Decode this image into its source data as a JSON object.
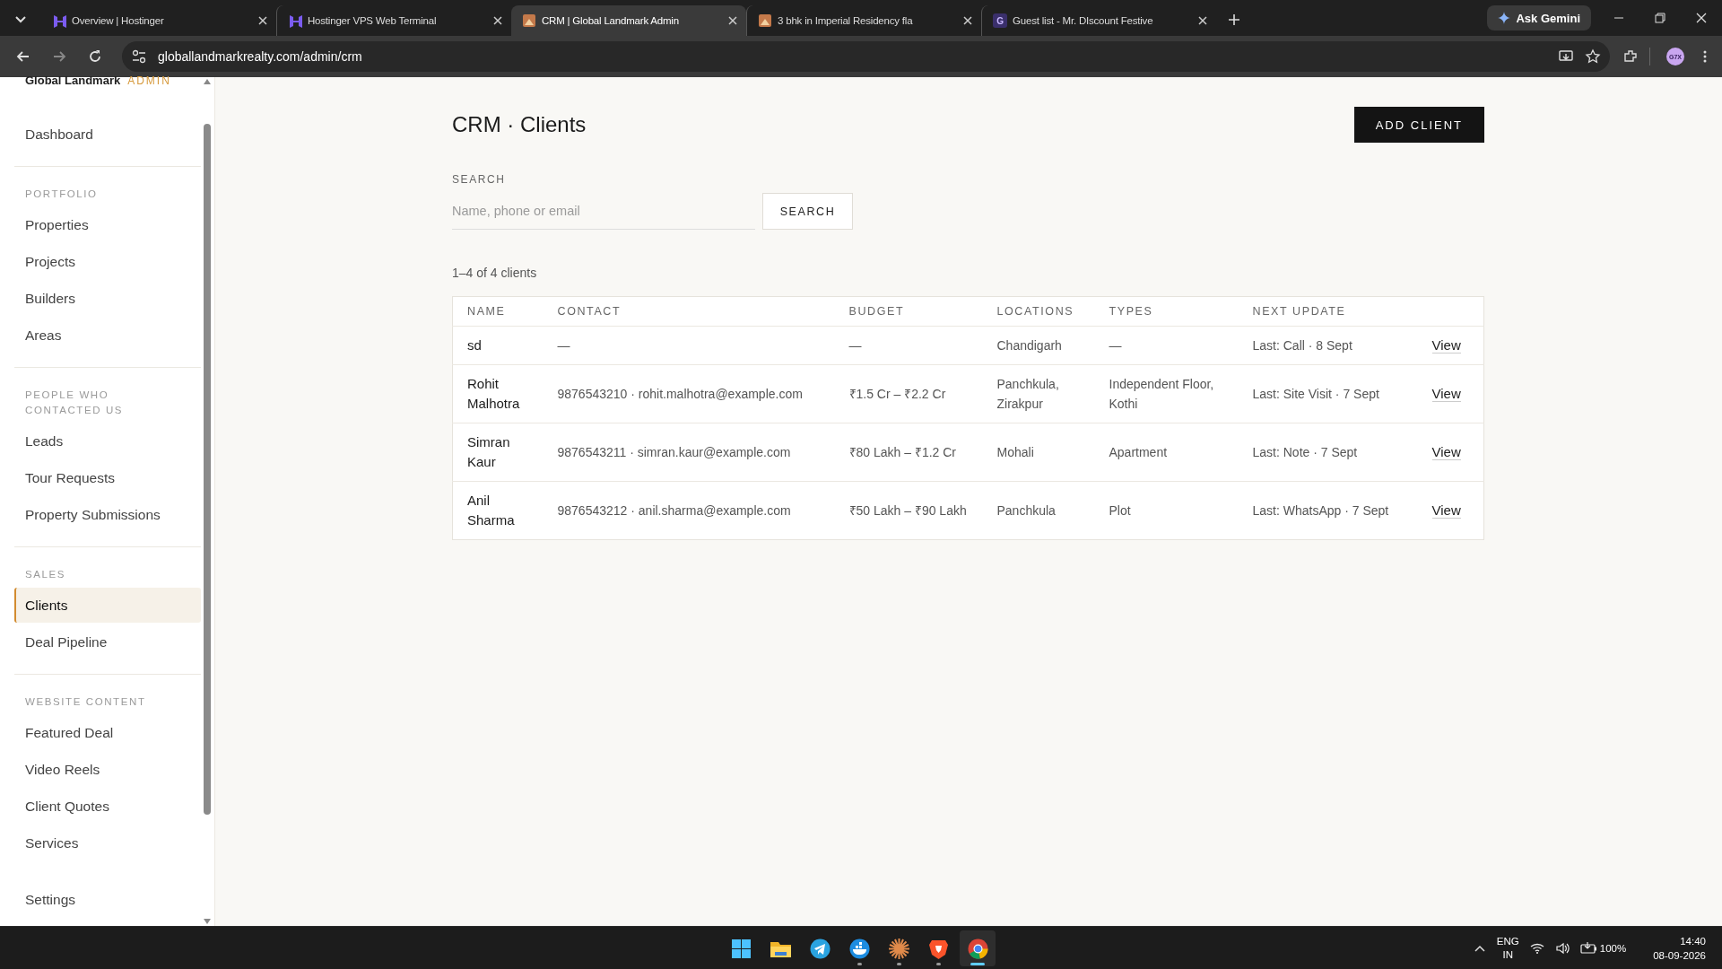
{
  "browser": {
    "tabs": [
      {
        "title": "Overview | Hostinger",
        "kind": "hostinger",
        "selected": false
      },
      {
        "title": "Hostinger VPS Web Terminal",
        "kind": "hostinger",
        "selected": false
      },
      {
        "title": "CRM | Global Landmark Admin",
        "kind": "site",
        "selected": true
      },
      {
        "title": "3 bhk in Imperial Residency fla",
        "kind": "site",
        "selected": false
      },
      {
        "title": "Guest list - Mr. DIscount Festive",
        "kind": "letter",
        "favicon_text": "G",
        "selected": false
      }
    ],
    "ask_button": "Ask Gemini",
    "url": "globallandmarkrealty.com/admin/crm",
    "profile_text": "G7X"
  },
  "sidebar": {
    "brand": "Global Landmark",
    "brand_tag": "ADMIN",
    "sections": [
      {
        "items": [
          {
            "label": "Dashboard",
            "selected": false
          }
        ]
      },
      {
        "label": "PORTFOLIO",
        "items": [
          {
            "label": "Properties",
            "selected": false
          },
          {
            "label": "Projects",
            "selected": false
          },
          {
            "label": "Builders",
            "selected": false
          },
          {
            "label": "Areas",
            "selected": false
          }
        ]
      },
      {
        "label": "PEOPLE WHO CONTACTED US",
        "items": [
          {
            "label": "Leads",
            "selected": false
          },
          {
            "label": "Tour Requests",
            "selected": false
          },
          {
            "label": "Property Submissions",
            "selected": false
          }
        ]
      },
      {
        "label": "SALES",
        "items": [
          {
            "label": "Clients",
            "selected": true
          },
          {
            "label": "Deal Pipeline",
            "selected": false
          }
        ]
      },
      {
        "label": "WEBSITE CONTENT",
        "items": [
          {
            "label": "Featured Deal",
            "selected": false
          },
          {
            "label": "Video Reels",
            "selected": false
          },
          {
            "label": "Client Quotes",
            "selected": false
          },
          {
            "label": "Services",
            "selected": false
          }
        ]
      },
      {
        "items": [
          {
            "label": "Settings",
            "selected": false
          }
        ]
      }
    ]
  },
  "page": {
    "title": "CRM · Clients",
    "add_button": "ADD CLIENT",
    "search_label": "SEARCH",
    "search_placeholder": "Name, phone or email",
    "search_button": "SEARCH",
    "count": "1–4 of 4 clients",
    "table": {
      "columns": [
        "NAME",
        "CONTACT",
        "BUDGET",
        "LOCATIONS",
        "TYPES",
        "NEXT UPDATE"
      ],
      "rows": [
        {
          "name": "sd",
          "contact": "—",
          "budget": "—",
          "locations": "Chandigarh",
          "types": "—",
          "next_update": "Last: Call · 8 Sept",
          "action": "View"
        },
        {
          "name": "Rohit Malhotra",
          "contact": "9876543210 · rohit.malhotra@example.com",
          "budget": "₹1.5 Cr – ₹2.2 Cr",
          "locations": "Panchkula, Zirakpur",
          "types": "Independent Floor, Kothi",
          "next_update": "Last: Site Visit · 7 Sept",
          "action": "View"
        },
        {
          "name": "Simran Kaur",
          "contact": "9876543211 · simran.kaur@example.com",
          "budget": "₹80 Lakh – ₹1.2 Cr",
          "locations": "Mohali",
          "types": "Apartment",
          "next_update": "Last: Note · 7 Sept",
          "action": "View"
        },
        {
          "name": "Anil Sharma",
          "contact": "9876543212 · anil.sharma@example.com",
          "budget": "₹50 Lakh – ₹90 Lakh",
          "locations": "Panchkula",
          "types": "Plot",
          "next_update": "Last: WhatsApp · 7 Sept",
          "action": "View"
        }
      ]
    }
  },
  "taskbar": {
    "apps": [
      {
        "kind": "start",
        "running": false,
        "active": false
      },
      {
        "kind": "files",
        "running": false,
        "active": false
      },
      {
        "kind": "telegram",
        "running": false,
        "active": false
      },
      {
        "kind": "docker",
        "running": true,
        "active": false
      },
      {
        "kind": "burst",
        "running": true,
        "active": false
      },
      {
        "kind": "brave",
        "running": true,
        "active": false
      },
      {
        "kind": "chrome",
        "running": true,
        "active": true
      }
    ],
    "language": "ENG",
    "region": "IN",
    "battery": "100%",
    "time": "14:40",
    "date": "08-09-2026"
  }
}
